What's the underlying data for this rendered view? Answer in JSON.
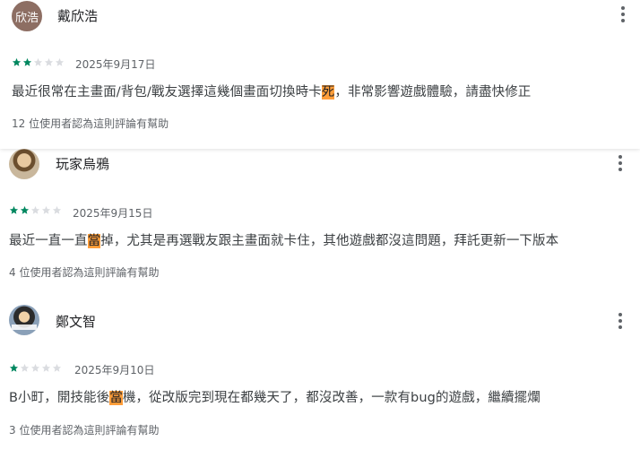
{
  "reviews": [
    {
      "avatar_text": "欣浩",
      "name": "戴欣浩",
      "rating": 2,
      "date": "2025年9月17日",
      "text_before": "最近很常在主畫面/背包/戰友選擇這幾個畫面切換時卡",
      "text_highlight": "死",
      "text_after": "，非常影響遊戲體驗，請盡快修正",
      "helpful": "12 位使用者認為這則評論有幫助"
    },
    {
      "avatar_text": "",
      "name": "玩家烏鴉",
      "rating": 2,
      "date": "2025年9月15日",
      "text_before": "最近一直一直",
      "text_highlight": "當",
      "text_after": "掉，尤其是再選戰友跟主畫面就卡住，其他遊戲都沒這問題，拜託更新一下版本",
      "helpful": "4 位使用者認為這則評論有幫助"
    },
    {
      "avatar_text": "",
      "name": "鄭文智",
      "rating": 1,
      "date": "2025年9月10日",
      "text_before": "B小町，開技能後",
      "text_highlight": "當",
      "text_after": "機，從改版完到現在都幾天了，都沒改善，一款有bug的遊戲，繼續擺爛",
      "helpful": "3 位使用者認為這則評論有幫助"
    }
  ],
  "colors": {
    "star_filled": "#01875f",
    "star_empty": "#dadce0",
    "highlight": "#ff9e3a",
    "avatar_bg": "#8d6e63"
  },
  "icons": {
    "menu": "more-vert-icon",
    "star": "star-icon"
  }
}
